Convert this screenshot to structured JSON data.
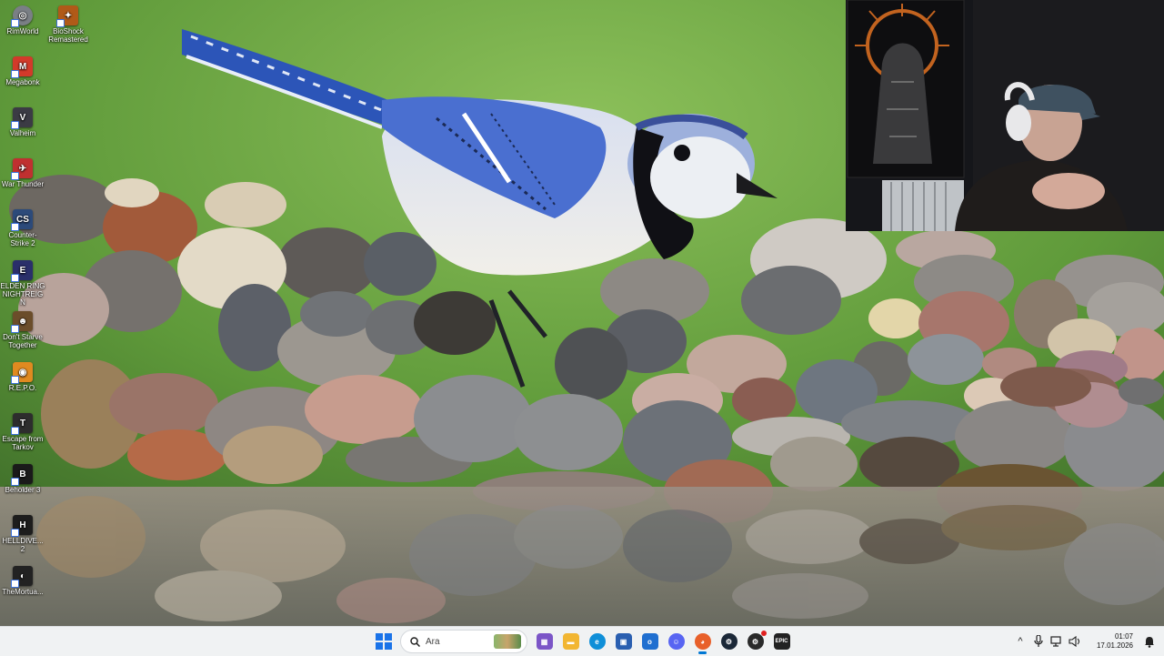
{
  "desktop": {
    "icons": [
      {
        "label": "RimWorld",
        "icon": "rimworld-icon",
        "color": "#7a7f85"
      },
      {
        "label": "BioShock Remastered",
        "icon": "bioshock-icon",
        "color": "#b05a18"
      },
      {
        "label": "Megabonk",
        "icon": "megabonk-icon",
        "color": "#d23a2a"
      },
      {
        "label": "Valheim",
        "icon": "valheim-icon",
        "color": "#3b3b44"
      },
      {
        "label": "War Thunder",
        "icon": "war-thunder-icon",
        "color": "#c03030"
      },
      {
        "label": "Counter-Strike 2",
        "icon": "counter-strike-icon",
        "color": "#2c4a7a"
      },
      {
        "label": "ELDEN RING NIGHTREIGN",
        "icon": "elden-ring-icon",
        "color": "#2a2f6a"
      },
      {
        "label": "Don't Starve Together",
        "icon": "dont-starve-icon",
        "color": "#6b4d2a"
      },
      {
        "label": "R.E.P.O.",
        "icon": "repo-icon",
        "color": "#e08a20"
      },
      {
        "label": "Escape from Tarkov",
        "icon": "tarkov-icon",
        "color": "#2d2d2d"
      },
      {
        "label": "Beholder 3",
        "icon": "beholder-icon",
        "color": "#1a1a1a"
      },
      {
        "label": "HELLDIVE... 2",
        "icon": "helldivers-icon",
        "color": "#1d1d1d"
      },
      {
        "label": "TheMortua...",
        "icon": "mortuary-icon",
        "color": "#222222"
      }
    ]
  },
  "taskbar": {
    "search_placeholder": "Ara",
    "apps": [
      {
        "name": "start-button",
        "icon": "windows-icon",
        "color": "#1a73e8"
      },
      {
        "name": "widgets-button",
        "icon": "widgets-icon",
        "color": "#7b55c7"
      },
      {
        "name": "file-explorer-button",
        "icon": "folder-icon",
        "color": "#f2b632"
      },
      {
        "name": "edge-button",
        "icon": "edge-icon",
        "color": "#0f8fd8"
      },
      {
        "name": "store-button",
        "icon": "store-icon",
        "color": "#2a5fb0"
      },
      {
        "name": "outlook-button",
        "icon": "outlook-icon",
        "color": "#1f6fd0"
      },
      {
        "name": "discord-button",
        "icon": "discord-icon",
        "color": "#5865f2"
      },
      {
        "name": "firefox-button",
        "icon": "firefox-icon",
        "color": "#e8602a"
      },
      {
        "name": "steam-button",
        "icon": "steam-icon",
        "color": "#1b2838"
      },
      {
        "name": "steam-alt-button",
        "icon": "steam-notify-icon",
        "color": "#2a2a2a"
      },
      {
        "name": "epic-games-button",
        "icon": "epic-games-icon",
        "color": "#222222"
      }
    ],
    "tray": {
      "chevron": "^",
      "time": "01:07",
      "date": "17.01.2026"
    }
  }
}
